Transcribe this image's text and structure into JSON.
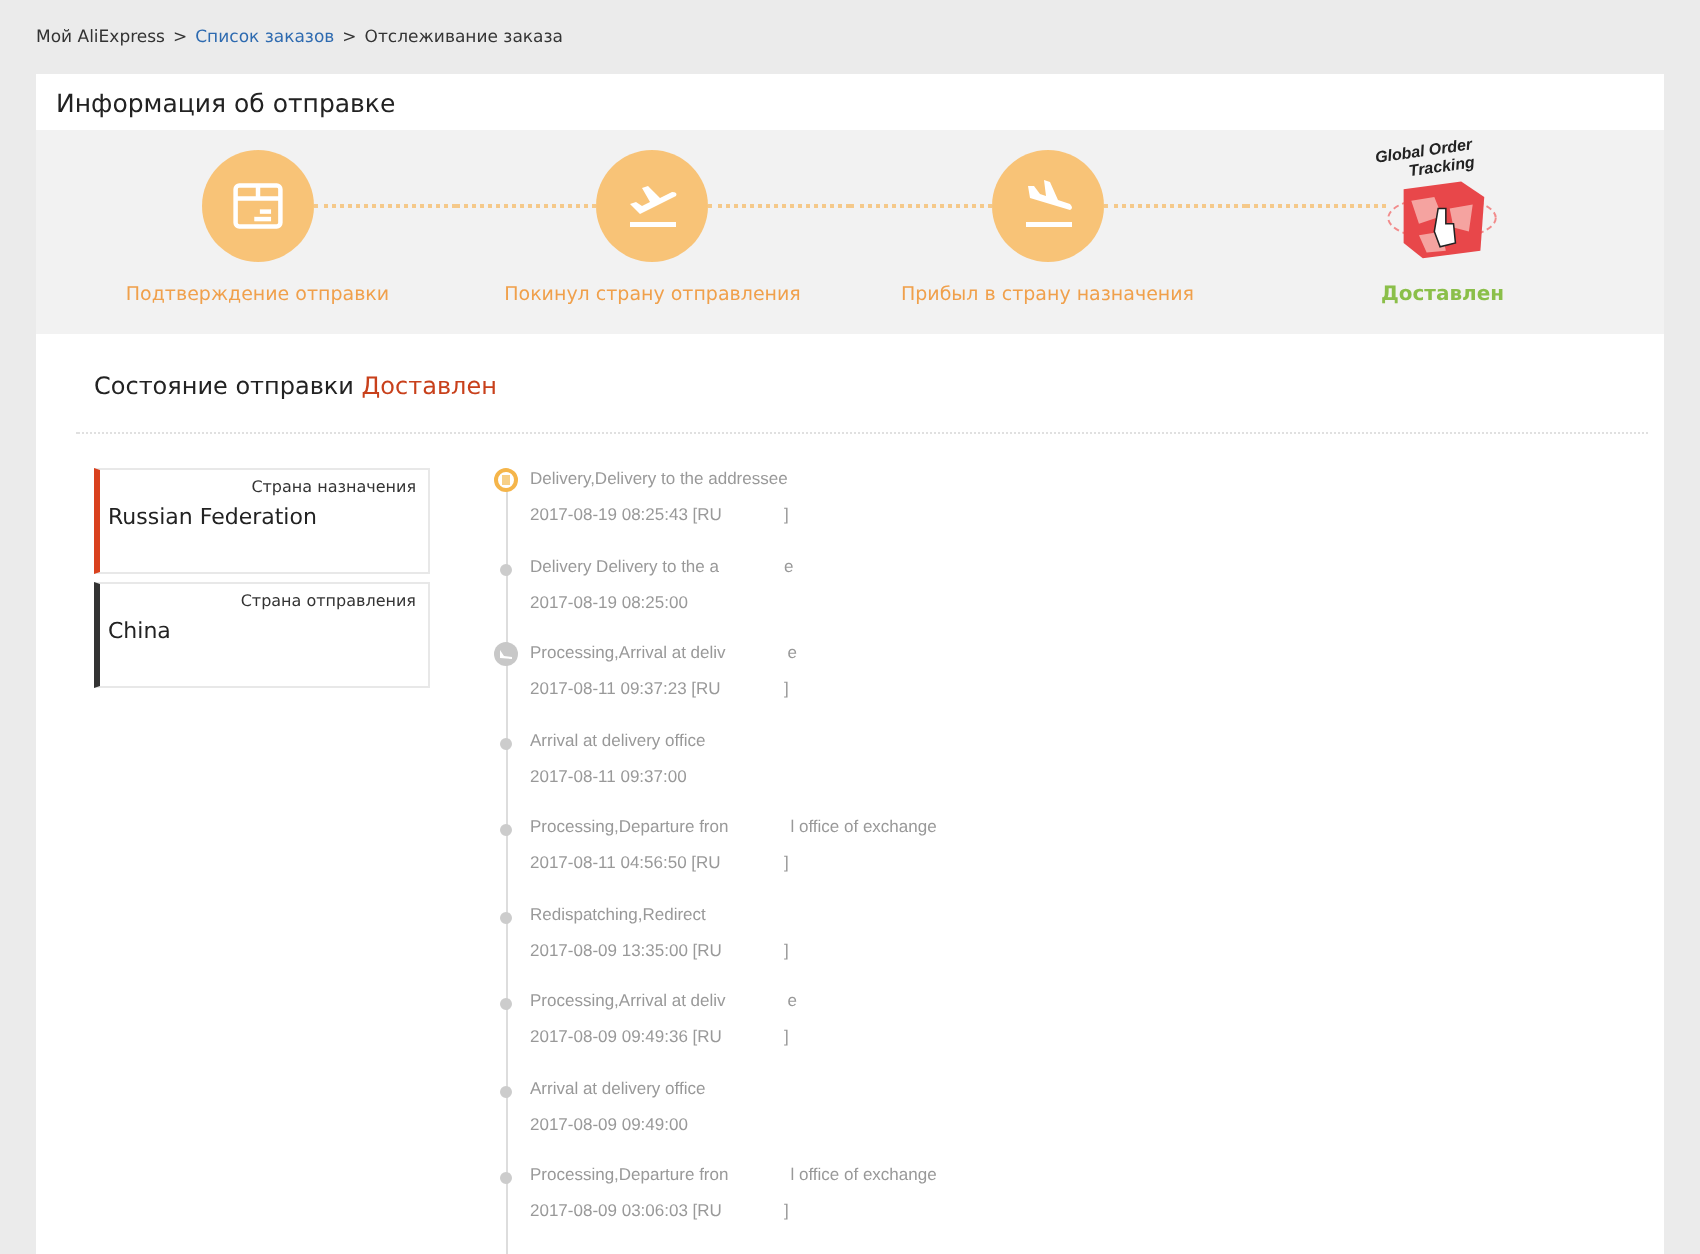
{
  "breadcrumb": [
    {
      "label": "Мой AliExpress",
      "link": false
    },
    {
      "label": "Список заказов",
      "link": true
    },
    {
      "label": "Отслеживание заказа",
      "link": false
    }
  ],
  "breadcrumb_separator": ">",
  "panel_title": "Информация об отправке",
  "steps": [
    {
      "kind": "box",
      "label": "Подтверждение отправки",
      "done": false
    },
    {
      "kind": "takeoff",
      "label": "Покинул страну отправления",
      "done": false
    },
    {
      "kind": "landing",
      "label": "Прибыл в страну назначения",
      "done": false
    },
    {
      "kind": "logo",
      "label": "Доставлен",
      "done": true,
      "logo_text": [
        "Global Order",
        "Tracking"
      ]
    }
  ],
  "status": {
    "label": "Состояние отправки",
    "value": "Доставлен"
  },
  "countries": [
    {
      "caption": "Страна назначения",
      "name": "Russian Federation",
      "color": "#d9411e"
    },
    {
      "caption": "Страна отправления",
      "name": "China",
      "color": "#333333"
    }
  ],
  "events": [
    {
      "kind": "current",
      "title": [
        "Delivery,Delivery to the addressee"
      ],
      "time": [
        "2017-08-19 08:25:43 [RU",
        "]"
      ]
    },
    {
      "kind": "dot",
      "title": [
        "Delivery Delivery to the a",
        "e"
      ],
      "time": [
        "2017-08-19 08:25:00"
      ]
    },
    {
      "kind": "plane",
      "title": [
        "Processing,Arrival at deliv",
        "e"
      ],
      "time": [
        "2017-08-11 09:37:23 [RU",
        "]"
      ]
    },
    {
      "kind": "dot",
      "title": [
        "Arrival at delivery office"
      ],
      "time": [
        "2017-08-11 09:37:00"
      ]
    },
    {
      "kind": "dot",
      "title": [
        "Processing,Departure fron",
        "l office of exchange"
      ],
      "time": [
        "2017-08-11 04:56:50 [RU",
        "]"
      ]
    },
    {
      "kind": "dot",
      "title": [
        "Redispatching,Redirect"
      ],
      "time": [
        "2017-08-09 13:35:00 [RU",
        "]"
      ]
    },
    {
      "kind": "dot",
      "title": [
        "Processing,Arrival at deliv",
        "e"
      ],
      "time": [
        "2017-08-09 09:49:36 [RU",
        "]"
      ]
    },
    {
      "kind": "dot",
      "title": [
        "Arrival at delivery office"
      ],
      "time": [
        "2017-08-09 09:49:00"
      ]
    },
    {
      "kind": "dot",
      "title": [
        "Processing,Departure fron",
        "l office of exchange"
      ],
      "time": [
        "2017-08-09 03:06:03 [RU",
        "]"
      ]
    }
  ]
}
